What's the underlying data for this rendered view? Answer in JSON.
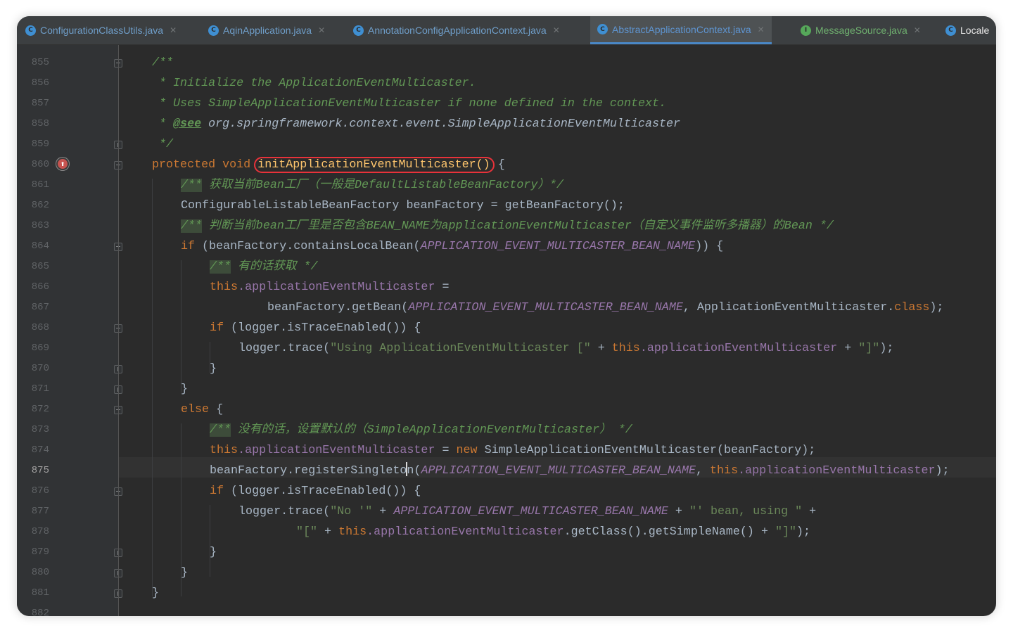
{
  "tabs": [
    {
      "label": "ConfigurationClassUtils.java",
      "icon": "class-icon",
      "active": false
    },
    {
      "label": "AqinApplication.java",
      "icon": "class-icon",
      "active": false
    },
    {
      "label": "AnnotationConfigApplicationContext.java",
      "icon": "class-icon",
      "active": false
    },
    {
      "label": "AbstractApplicationContext.java",
      "icon": "abstract-class-icon",
      "active": true
    },
    {
      "label": "MessageSource.java",
      "icon": "interface-icon",
      "active": false
    },
    {
      "label": "Locale",
      "icon": "class-icon",
      "active": false
    }
  ],
  "editor": {
    "line_numbers": [
      "855",
      "856",
      "857",
      "858",
      "859",
      "860",
      "861",
      "862",
      "863",
      "864",
      "865",
      "866",
      "867",
      "868",
      "869",
      "870",
      "871",
      "872",
      "873",
      "874",
      "875",
      "876",
      "877",
      "878",
      "879",
      "880",
      "881",
      "882"
    ],
    "current_line": "875",
    "lines": {
      "l855": "/**",
      "l856": " * Initialize the ApplicationEventMulticaster.",
      "l857": " * Uses SimpleApplicationEventMulticaster if none defined in the context.",
      "l858_star": " * ",
      "l858_tag": "@see",
      "l858_ref": " org.springframework.context.event.SimpleApplicationEventMulticaster",
      "l859": " */",
      "l860_kw": "protected void ",
      "l860_name": "initApplicationEventMulticaster()",
      "l860_tail": " {",
      "l861_open": "/**",
      "l861_text": " 获取当前Bean工厂（一般是DefaultListableBeanFactory）*/",
      "l862": "ConfigurableListableBeanFactory beanFactory = getBeanFactory();",
      "l863_open": "/**",
      "l863_text": " 判断当前bean工厂里是否包含BEAN_NAME为applicationEventMulticaster（自定义事件监听多播器）的Bean */",
      "l864_kw": "if ",
      "l864_a": "(beanFactory.containsLocalBean(",
      "l864_const": "APPLICATION_EVENT_MULTICASTER_BEAN_NAME",
      "l864_b": ")) {",
      "l865_open": "/**",
      "l865_text": " 有的话获取 */",
      "l866_kw": "this",
      "l866_field": ".applicationEventMulticaster",
      "l866_tail": " =",
      "l867_a": "beanFactory.getBean(",
      "l867_const": "APPLICATION_EVENT_MULTICASTER_BEAN_NAME",
      "l867_b": ", ApplicationEventMulticaster.",
      "l867_kw": "class",
      "l867_c": ");",
      "l868_kw": "if ",
      "l868_a": "(logger.isTraceEnabled()) {",
      "l869_a": "logger.trace(",
      "l869_str": "\"Using ApplicationEventMulticaster [\"",
      "l869_b": " + ",
      "l869_kw": "this",
      "l869_field": ".applicationEventMulticaster",
      "l869_c": " + ",
      "l869_str2": "\"]\"",
      "l869_d": ");",
      "l870": "}",
      "l871": "}",
      "l872_kw": "else",
      "l872_tail": " {",
      "l873_open": "/**",
      "l873_text": " 没有的话，设置默认的（SimpleApplicationEventMulticaster） */",
      "l874_kw": "this",
      "l874_field": ".applicationEventMulticaster",
      "l874_a": " = ",
      "l874_kw2": "new ",
      "l874_b": "SimpleApplicationEventMulticaster(beanFactory);",
      "l875_a": "beanFactory.registerSinglet",
      "l875_b": "o",
      "l875_c": "n(",
      "l875_const": "APPLICATION_EVENT_MULTICASTER_BEAN_NAME",
      "l875_d": ", ",
      "l875_kw": "this",
      "l875_field": ".applicationEventMulticaster",
      "l875_e": ");",
      "l876_kw": "if ",
      "l876_a": "(logger.isTraceEnabled()) {",
      "l877_a": "logger.trace(",
      "l877_str": "\"No '\"",
      "l877_b": " + ",
      "l877_const": "APPLICATION_EVENT_MULTICASTER_BEAN_NAME",
      "l877_c": " + ",
      "l877_str2": "\"' bean, using \"",
      "l877_d": " +",
      "l878_str": "\"[\"",
      "l878_a": " + ",
      "l878_kw": "this",
      "l878_field": ".applicationEventMulticaster",
      "l878_b": ".getClass().getSimpleName() + ",
      "l878_str2": "\"]\"",
      "l878_c": ");",
      "l879": "}",
      "l880": "}",
      "l881": "}"
    }
  },
  "colors": {
    "background": "#2b2b2b",
    "keyword": "#cc7832",
    "comment": "#629755",
    "string": "#6a8759",
    "constant": "#9876aa",
    "highlight_box": "#e8323a",
    "active_tab_underline": "#4a88c7"
  }
}
